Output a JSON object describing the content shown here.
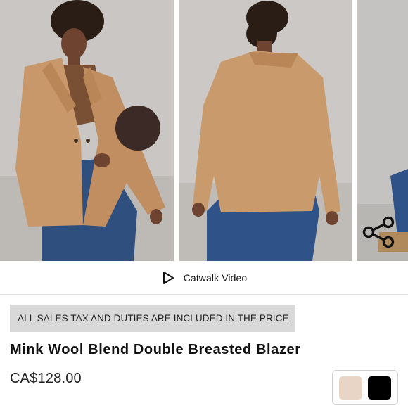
{
  "gallery": {
    "share_icon": "share-icon",
    "images": [
      "model-front-view",
      "model-back-view",
      "model-side-view-partial"
    ]
  },
  "video": {
    "icon": "play-icon",
    "label": "Catwalk Video"
  },
  "tax_banner": {
    "text": "ALL SALES TAX AND DUTIES ARE INCLUDED IN THE PRICE"
  },
  "product": {
    "title": "Mink Wool Blend Double Breasted Blazer",
    "price": "CA$128.00"
  },
  "swatches": {
    "colors": [
      "#e8d5c6",
      "#000000"
    ],
    "selected_index": 0
  }
}
